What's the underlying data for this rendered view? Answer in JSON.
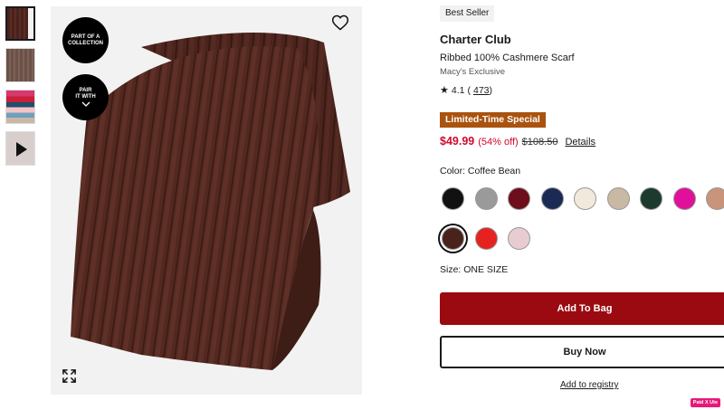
{
  "thumbnails": [
    {
      "name": "thumbnail-scarf-folded",
      "active": true
    },
    {
      "name": "thumbnail-scarf-texture",
      "active": false
    },
    {
      "name": "thumbnail-scarf-colors",
      "active": false
    },
    {
      "name": "thumbnail-video",
      "active": false
    }
  ],
  "main_image": {
    "collection_badge_line1": "PART OF A",
    "collection_badge_line2": "COLLECTION",
    "pair_badge_line1": "PAIR",
    "pair_badge_line2": "IT WITH",
    "heart_icon": "heart-outline-icon",
    "expand_icon": "expand-icon"
  },
  "product": {
    "badge": "Best Seller",
    "brand": "Charter Club",
    "name": "Ribbed 100% Cashmere Scarf",
    "exclusive": "Macy's Exclusive",
    "rating": "4.1",
    "review_count_open": "(",
    "review_count": "473",
    "review_count_close": ")",
    "promo": "Limited-Time Special",
    "sale_price": "$49.99",
    "percent_off": "(54% off)",
    "original_price": "$108.50",
    "details_link": "Details",
    "color_label": "Color: Coffee Bean",
    "size_label": "Size: ONE SIZE",
    "add_to_bag": "Add To Bag",
    "buy_now": "Buy Now",
    "registry": "Add to registry",
    "paid_tag": "Paid X Ute"
  },
  "swatches": [
    {
      "color": "#111111",
      "selected": false
    },
    {
      "color": "#9a9a9a",
      "selected": false
    },
    {
      "color": "#6e0d1c",
      "selected": false
    },
    {
      "color": "#1b2a55",
      "selected": false
    },
    {
      "color": "#f1e9dc",
      "selected": false
    },
    {
      "color": "#c9b8a4",
      "selected": false
    },
    {
      "color": "#1d3a2f",
      "selected": false
    },
    {
      "color": "#e0109a",
      "selected": false
    },
    {
      "color": "#c99479",
      "selected": false
    },
    {
      "color": "#4a221c",
      "selected": true
    },
    {
      "color": "#e5221f",
      "selected": false
    },
    {
      "color": "#e8ccd2",
      "selected": false
    }
  ],
  "colors": {
    "sale_red": "#cf0a2c",
    "promo_bg": "#a9530f",
    "bag_button": "#9b0a10"
  }
}
